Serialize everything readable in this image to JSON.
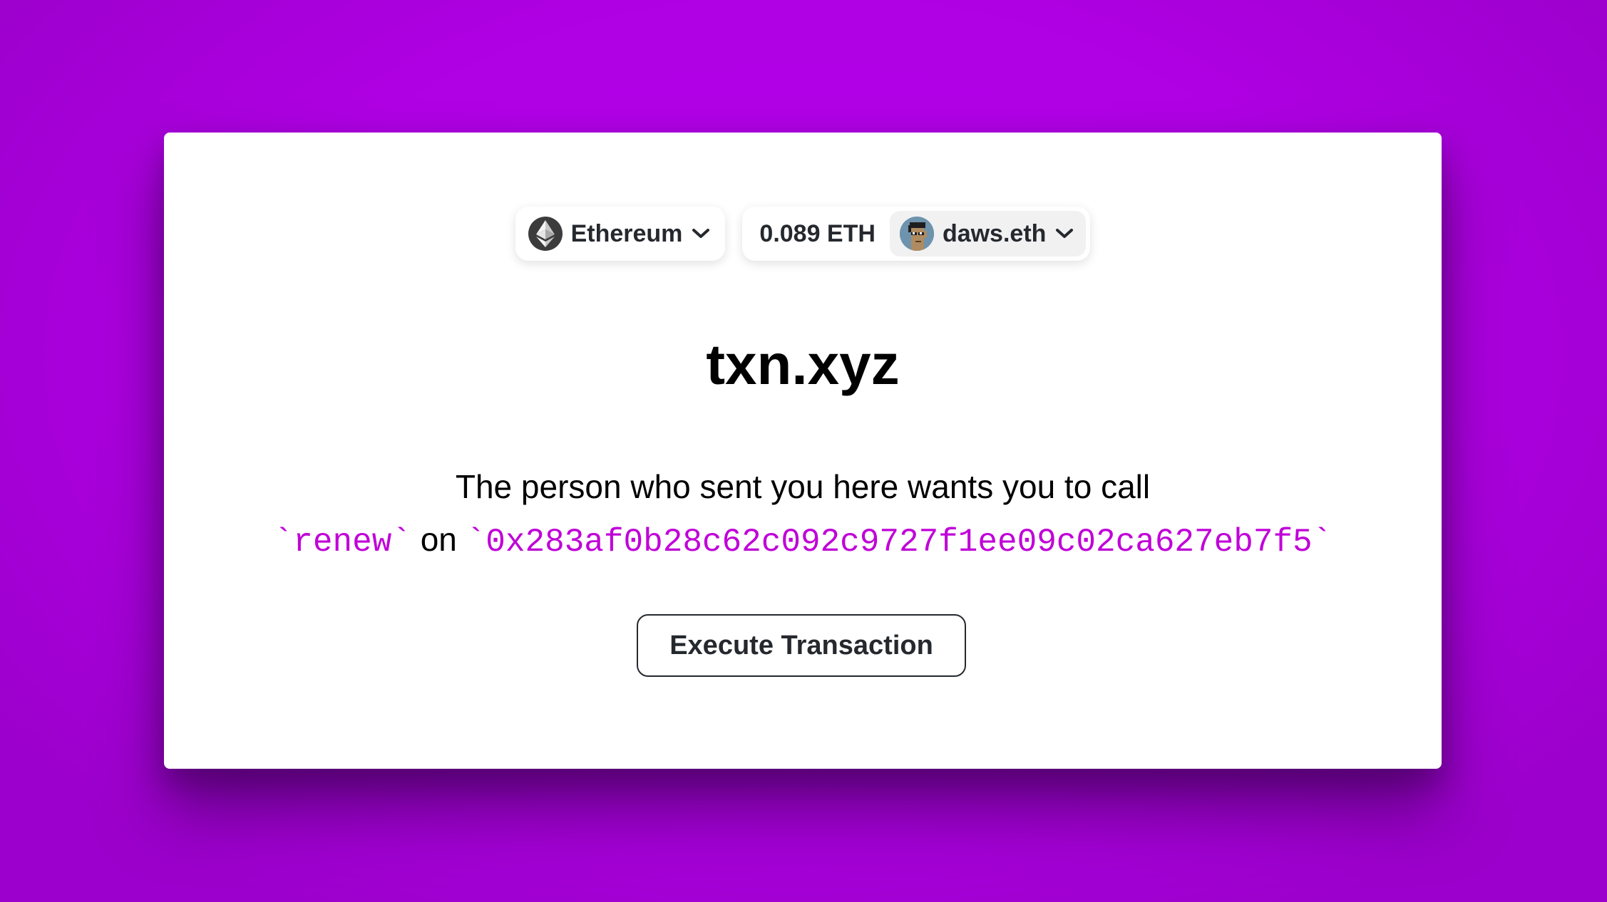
{
  "header": {
    "chain": {
      "name": "Ethereum",
      "icon": "ethereum-icon"
    },
    "account": {
      "balance": "0.089 ETH",
      "name": "daws.eth",
      "avatar_icon": "punk-avatar-icon"
    }
  },
  "main": {
    "title": "txn.xyz",
    "message_line1": "The person who sent you here wants you to call",
    "function_name": "`renew`",
    "connector": "on",
    "contract_address": "`0x283af0b28c62c092c9727f1ee09c02ca627eb7f5`",
    "execute_label": "Execute Transaction"
  },
  "colors": {
    "background": "#b300e6",
    "code_accent": "#c000d8",
    "card": "#ffffff",
    "text_dark": "#25292e"
  }
}
